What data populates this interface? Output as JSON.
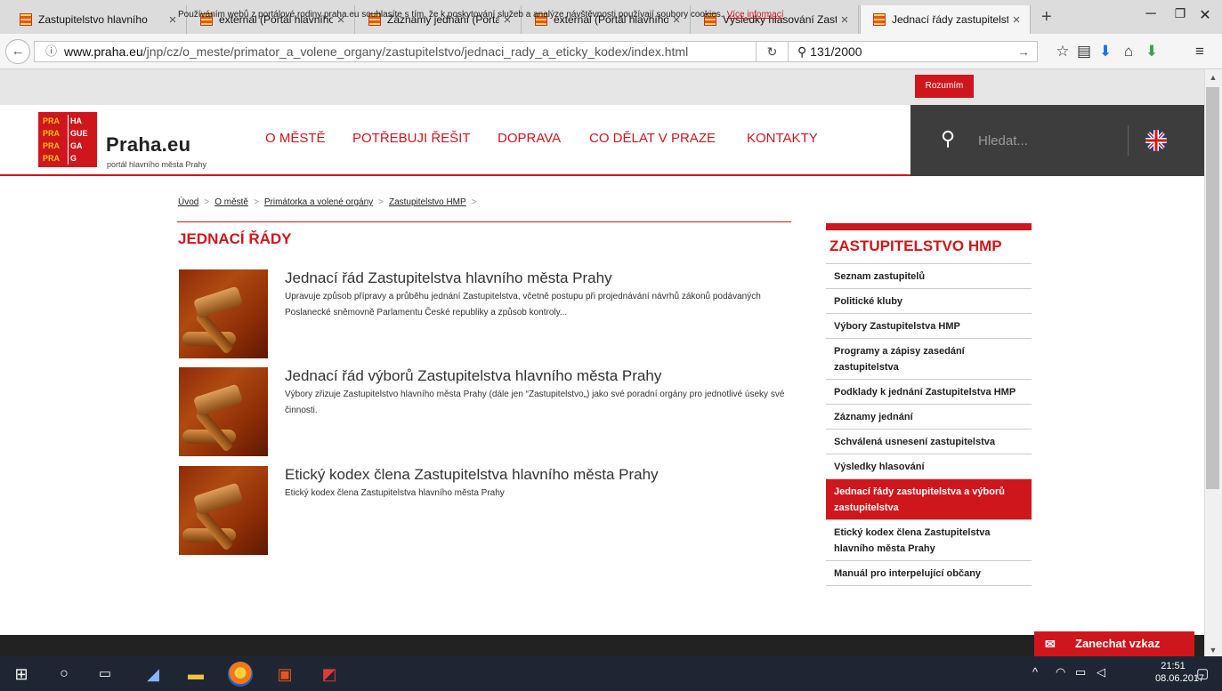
{
  "browser": {
    "tabs": [
      {
        "title": "Zastupitelstvo hlavního "
      },
      {
        "title": "external (Portál hlavního"
      },
      {
        "title": "Záznamy jednání (Portál"
      },
      {
        "title": "external (Portál hlavního"
      },
      {
        "title": "Výsledky hlasování Zastu"
      },
      {
        "title": "Jednací řády zastupitelst"
      }
    ],
    "url_host": "www.praha.eu",
    "url_path": "/jnp/cz/o_meste/primator_a_volene_organy/zastupitelstvo/jednaci_rady_a_eticky_kodex/index.html",
    "search_value": "131/2000",
    "search_placeholder": "Hledat"
  },
  "cookie_banner": {
    "text": "Používáním webů z portálové rodiny praha.eu souhlasíte s tím, že k poskytování služeb a analýze návštěvnosti používají soubory cookies.",
    "link": "Více informací",
    "button": "Rozumím"
  },
  "header": {
    "logo_cells": [
      "PRA",
      "HA",
      "PRA",
      "GUE",
      "PRA",
      "GA",
      "PRA",
      "G"
    ],
    "logo_text": "Praha.eu",
    "logo_sub": "portál hlavního města Prahy",
    "menu": [
      "O MĚSTĚ",
      "POTŘEBUJI ŘEŠIT",
      "DOPRAVA",
      "CO DĚLAT V PRAZE",
      "KONTAKTY"
    ],
    "search_placeholder": "Hledat..."
  },
  "breadcrumb": [
    "Úvod",
    "O městě",
    "Primátorka a volené orgány",
    "Zastupitelstvo HMP"
  ],
  "page_title": "JEDNACÍ ŘÁDY",
  "articles": [
    {
      "title": "Jednací řád Zastupitelstva hlavního města Prahy",
      "desc": "Upravuje způsob přípravy a průběhu jednání Zastupitelstva, včetně postupu při projednávání návrhů zákonů podávaných Poslanecké sněmovně Parlamentu České republiky a způsob kontroly..."
    },
    {
      "title": "Jednací řád výborů Zastupitelstva hlavního města Prahy",
      "desc": "Výbory zřizuje Zastupitelstvo hlavního města Prahy (dále jen “Zastupitelstvo„) jako své poradní orgány pro jednotlivé úseky své činnosti."
    },
    {
      "title": "Etický kodex člena Zastupitelstva hlavního města Prahy",
      "desc": "Etický kodex člena Zastupitelstva hlavního města Prahy"
    }
  ],
  "sidebar": {
    "title": "ZASTUPITELSTVO HMP",
    "items": [
      "Seznam zastupitelů",
      "Politické kluby",
      "Výbory Zastupitelstva HMP",
      "Programy a zápisy zasedání zastupitelstva",
      "Podklady k jednání Zastupitelstva HMP",
      "Záznamy jednání",
      "Schválená usnesení zastupitelstva",
      "Výsledky hlasování",
      "Jednací řády zastupitelstva a výborů zastupitelstva",
      "Etický kodex člena Zastupitelstva hlavního města Prahy",
      "Manuál pro interpelující občany"
    ],
    "active_index": 8
  },
  "feedback": "Zanechat vzkaz",
  "taskbar": {
    "time": "21:51",
    "date": "08.06.2017"
  }
}
